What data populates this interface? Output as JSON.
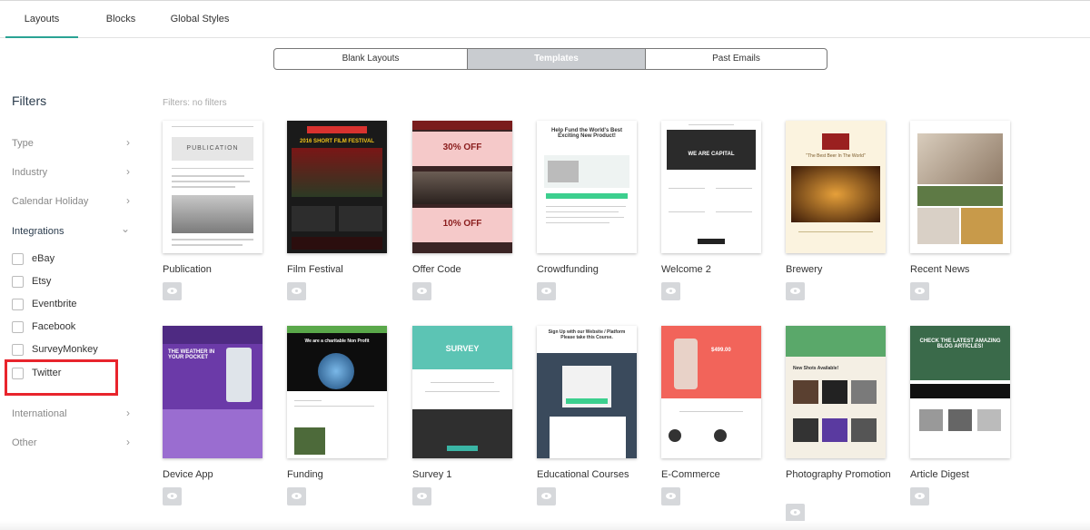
{
  "top_tabs": [
    {
      "label": "Layouts",
      "active": true
    },
    {
      "label": "Blocks",
      "active": false
    },
    {
      "label": "Global Styles",
      "active": false
    }
  ],
  "segments": [
    {
      "label": "Blank Layouts",
      "selected": false
    },
    {
      "label": "Templates",
      "selected": true
    },
    {
      "label": "Past Emails",
      "selected": false
    }
  ],
  "filters": {
    "title": "Filters",
    "status": "Filters: no filters",
    "groups": [
      "Type",
      "Industry",
      "Calendar Holiday",
      "Integrations",
      "International",
      "Other"
    ],
    "integrations": [
      "eBay",
      "Etsy",
      "Eventbrite",
      "Facebook",
      "SurveyMonkey",
      "Twitter"
    ],
    "highlighted": "Twitter"
  },
  "templates_row1": [
    {
      "name": "Publication",
      "thumb_text": "PUBLICATION"
    },
    {
      "name": "Film Festival",
      "thumb_text": "2016 SHORT FILM FESTIVAL"
    },
    {
      "name": "Offer Code",
      "thumb_text": "30% OFF",
      "thumb_text2": "10% OFF"
    },
    {
      "name": "Crowdfunding",
      "thumb_text": "Help Fund the World's Best Exciting New Product!"
    },
    {
      "name": "Welcome 2",
      "thumb_text": "WE ARE CAPITAL"
    },
    {
      "name": "Brewery",
      "thumb_text": "\"The Best Beer In The World\""
    },
    {
      "name": "Recent News",
      "thumb_text": ""
    }
  ],
  "templates_row2": [
    {
      "name": "Device App",
      "thumb_text": "THE WEATHER IN YOUR POCKET"
    },
    {
      "name": "Funding",
      "thumb_text": "We are a charitable Non Profit"
    },
    {
      "name": "Survey 1",
      "thumb_text": "SURVEY"
    },
    {
      "name": "Educational Courses",
      "thumb_text": "Sign Up with our Website / Platform Please take this Course."
    },
    {
      "name": "E-Commerce",
      "thumb_text": "$499.00"
    },
    {
      "name": "Photography Promotion",
      "thumb_text": "New Shots Available!"
    },
    {
      "name": "Article Digest",
      "thumb_text": "CHECK THE LATEST AMAZING BLOG ARTICLES!"
    }
  ],
  "colors": {
    "accent": "#2aa394",
    "highlight": "#e8242c",
    "selected_segment": "#c9ccd0"
  },
  "icons": {
    "chevron_right": "chevron-right-icon",
    "chevron_down": "chevron-down-icon",
    "preview": "eye-icon"
  }
}
